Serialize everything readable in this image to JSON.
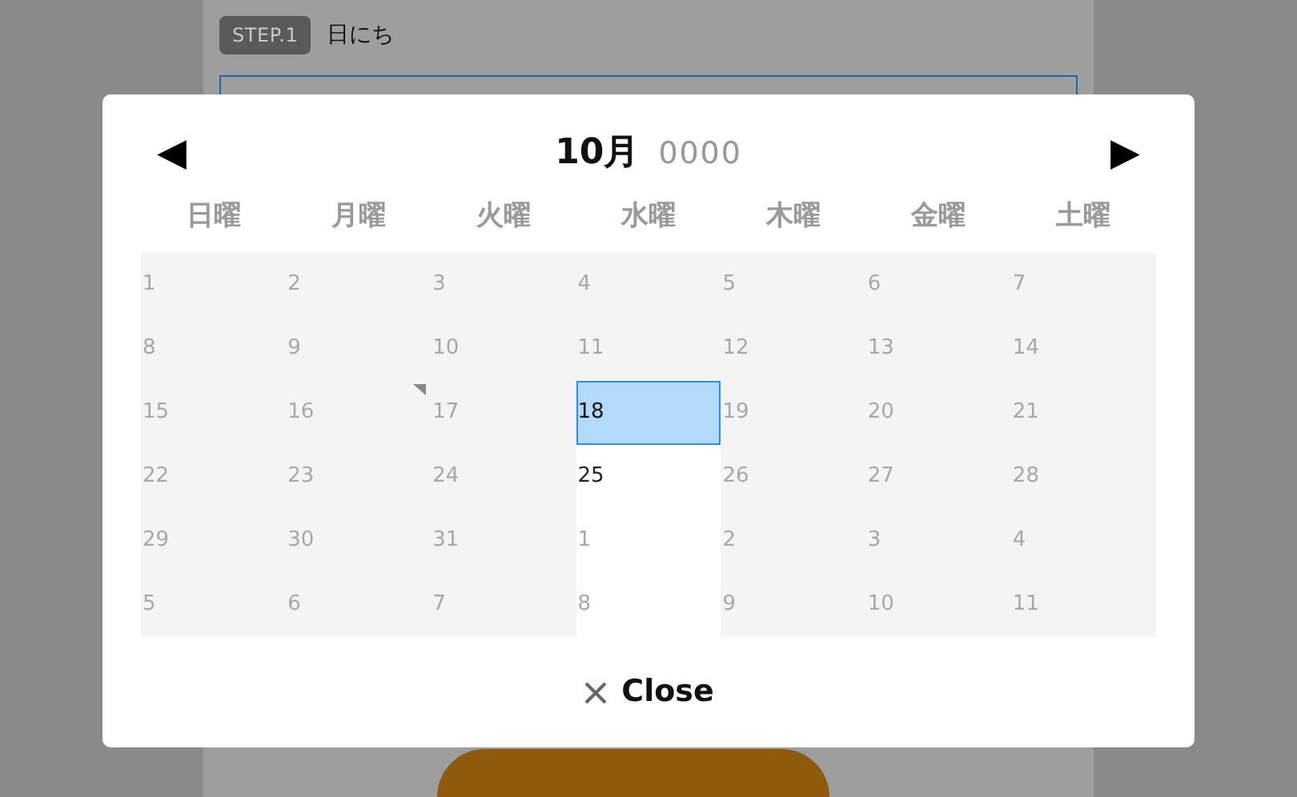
{
  "page": {
    "step_badge": "STEP.1",
    "step_label": "日にち"
  },
  "calendar": {
    "prev": "◀",
    "month": "10月",
    "year": "0000",
    "next": "▶",
    "weekdays": [
      "日曜",
      "月曜",
      "火曜",
      "水曜",
      "木曜",
      "金曜",
      "土曜"
    ],
    "days": [
      {
        "label": "1",
        "kind": "disabled",
        "marked": false
      },
      {
        "label": "2",
        "kind": "disabled",
        "marked": false
      },
      {
        "label": "3",
        "kind": "disabled",
        "marked": false
      },
      {
        "label": "4",
        "kind": "disabled",
        "marked": false
      },
      {
        "label": "5",
        "kind": "disabled",
        "marked": false
      },
      {
        "label": "6",
        "kind": "disabled",
        "marked": false
      },
      {
        "label": "7",
        "kind": "disabled",
        "marked": false
      },
      {
        "label": "8",
        "kind": "disabled",
        "marked": false
      },
      {
        "label": "9",
        "kind": "disabled",
        "marked": false
      },
      {
        "label": "10",
        "kind": "disabled",
        "marked": false
      },
      {
        "label": "11",
        "kind": "disabled",
        "marked": false
      },
      {
        "label": "12",
        "kind": "disabled",
        "marked": false
      },
      {
        "label": "13",
        "kind": "disabled",
        "marked": false
      },
      {
        "label": "14",
        "kind": "disabled",
        "marked": false
      },
      {
        "label": "15",
        "kind": "disabled",
        "marked": false
      },
      {
        "label": "16",
        "kind": "disabled",
        "marked": true
      },
      {
        "label": "17",
        "kind": "disabled",
        "marked": false
      },
      {
        "label": "18",
        "kind": "selected",
        "marked": false
      },
      {
        "label": "19",
        "kind": "disabled",
        "marked": false
      },
      {
        "label": "20",
        "kind": "disabled",
        "marked": false
      },
      {
        "label": "21",
        "kind": "disabled",
        "marked": false
      },
      {
        "label": "22",
        "kind": "disabled",
        "marked": false
      },
      {
        "label": "23",
        "kind": "disabled",
        "marked": false
      },
      {
        "label": "24",
        "kind": "disabled",
        "marked": false
      },
      {
        "label": "25",
        "kind": "open",
        "marked": false
      },
      {
        "label": "26",
        "kind": "disabled",
        "marked": false
      },
      {
        "label": "27",
        "kind": "disabled",
        "marked": false
      },
      {
        "label": "28",
        "kind": "disabled",
        "marked": false
      },
      {
        "label": "29",
        "kind": "disabled",
        "marked": false
      },
      {
        "label": "30",
        "kind": "disabled",
        "marked": false
      },
      {
        "label": "31",
        "kind": "disabled",
        "marked": false
      },
      {
        "label": "1",
        "kind": "outside",
        "marked": false
      },
      {
        "label": "2",
        "kind": "disabled",
        "marked": false
      },
      {
        "label": "3",
        "kind": "disabled",
        "marked": false
      },
      {
        "label": "4",
        "kind": "disabled",
        "marked": false
      },
      {
        "label": "5",
        "kind": "disabled",
        "marked": false
      },
      {
        "label": "6",
        "kind": "disabled",
        "marked": false
      },
      {
        "label": "7",
        "kind": "disabled",
        "marked": false
      },
      {
        "label": "8",
        "kind": "outside",
        "marked": false
      },
      {
        "label": "9",
        "kind": "disabled",
        "marked": false
      },
      {
        "label": "10",
        "kind": "disabled",
        "marked": false
      },
      {
        "label": "11",
        "kind": "disabled",
        "marked": false
      }
    ],
    "close": "Close"
  }
}
